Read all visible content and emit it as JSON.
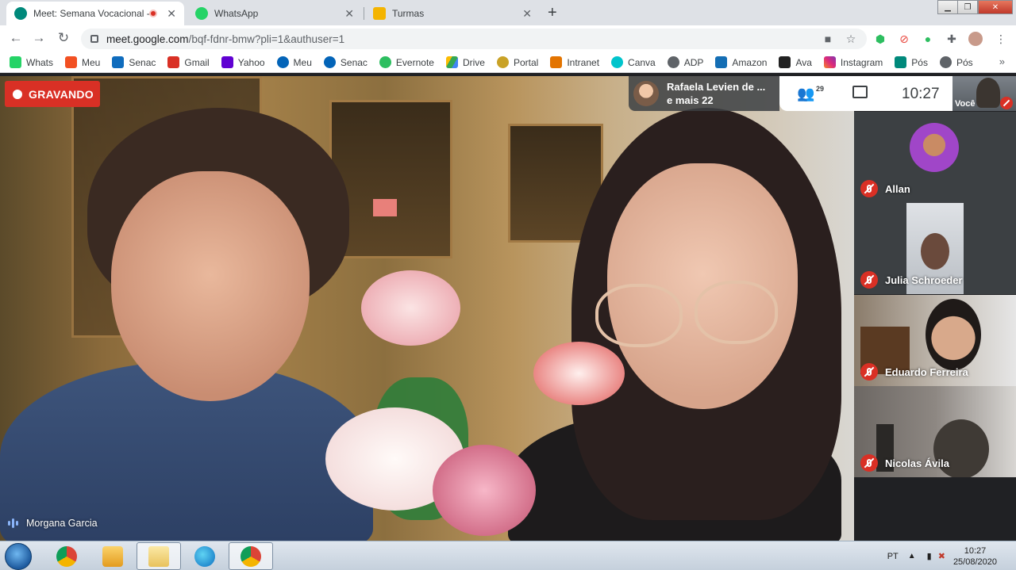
{
  "browser": {
    "tabs": [
      {
        "title": "Meet: Semana Vocacional - I",
        "active": true,
        "recording": true
      },
      {
        "title": "WhatsApp",
        "active": false
      },
      {
        "title": "Turmas",
        "active": false
      }
    ],
    "url_host": "meet.google.com",
    "url_path": "/bqf-fdnr-bmw?pli=1&authuser=1",
    "extension_badge": "0"
  },
  "bookmarks": [
    {
      "label": "Whats",
      "color": "#25d366"
    },
    {
      "label": "Meu",
      "color": "#f25022"
    },
    {
      "label": "Senac",
      "color": "#0f6cbd"
    },
    {
      "label": "Gmail",
      "color": "#d93025"
    },
    {
      "label": "Yahoo",
      "color": "#6001d2"
    },
    {
      "label": "Meu",
      "color": "#0364b8"
    },
    {
      "label": "Senac",
      "color": "#0364b8"
    },
    {
      "label": "Evernote",
      "color": "#2dbe60"
    },
    {
      "label": "Drive",
      "color": "#fbbc04"
    },
    {
      "label": "Portal",
      "color": "#c9a227"
    },
    {
      "label": "Intranet",
      "color": "#e37400"
    },
    {
      "label": "Canva",
      "color": "#00c4cc"
    },
    {
      "label": "ADP",
      "color": "#5f6368"
    },
    {
      "label": "Amazon",
      "color": "#146eb4"
    },
    {
      "label": "Ava",
      "color": "#222222"
    },
    {
      "label": "Instagram",
      "color": "#e1306c"
    },
    {
      "label": "Pós",
      "color": "#00897b"
    },
    {
      "label": "Pós",
      "color": "#5f6368"
    }
  ],
  "bookmarks_more": "»",
  "meet": {
    "recording_label": "GRAVANDO",
    "active_speaker": "Morgana Garcia",
    "presenter_line1": "Rafaela Levien de ...",
    "presenter_line2": "e mais 22",
    "participant_count": "29",
    "clock": "10:27",
    "self_label": "Você",
    "participants": [
      {
        "name": "Allan",
        "muted": true
      },
      {
        "name": "Julia Schroeder",
        "muted": true
      },
      {
        "name": "Eduardo Ferreira",
        "muted": true
      },
      {
        "name": "Nicolas Ávila",
        "muted": true
      }
    ]
  },
  "taskbar": {
    "language": "PT",
    "time": "10:27",
    "date": "25/08/2020"
  }
}
